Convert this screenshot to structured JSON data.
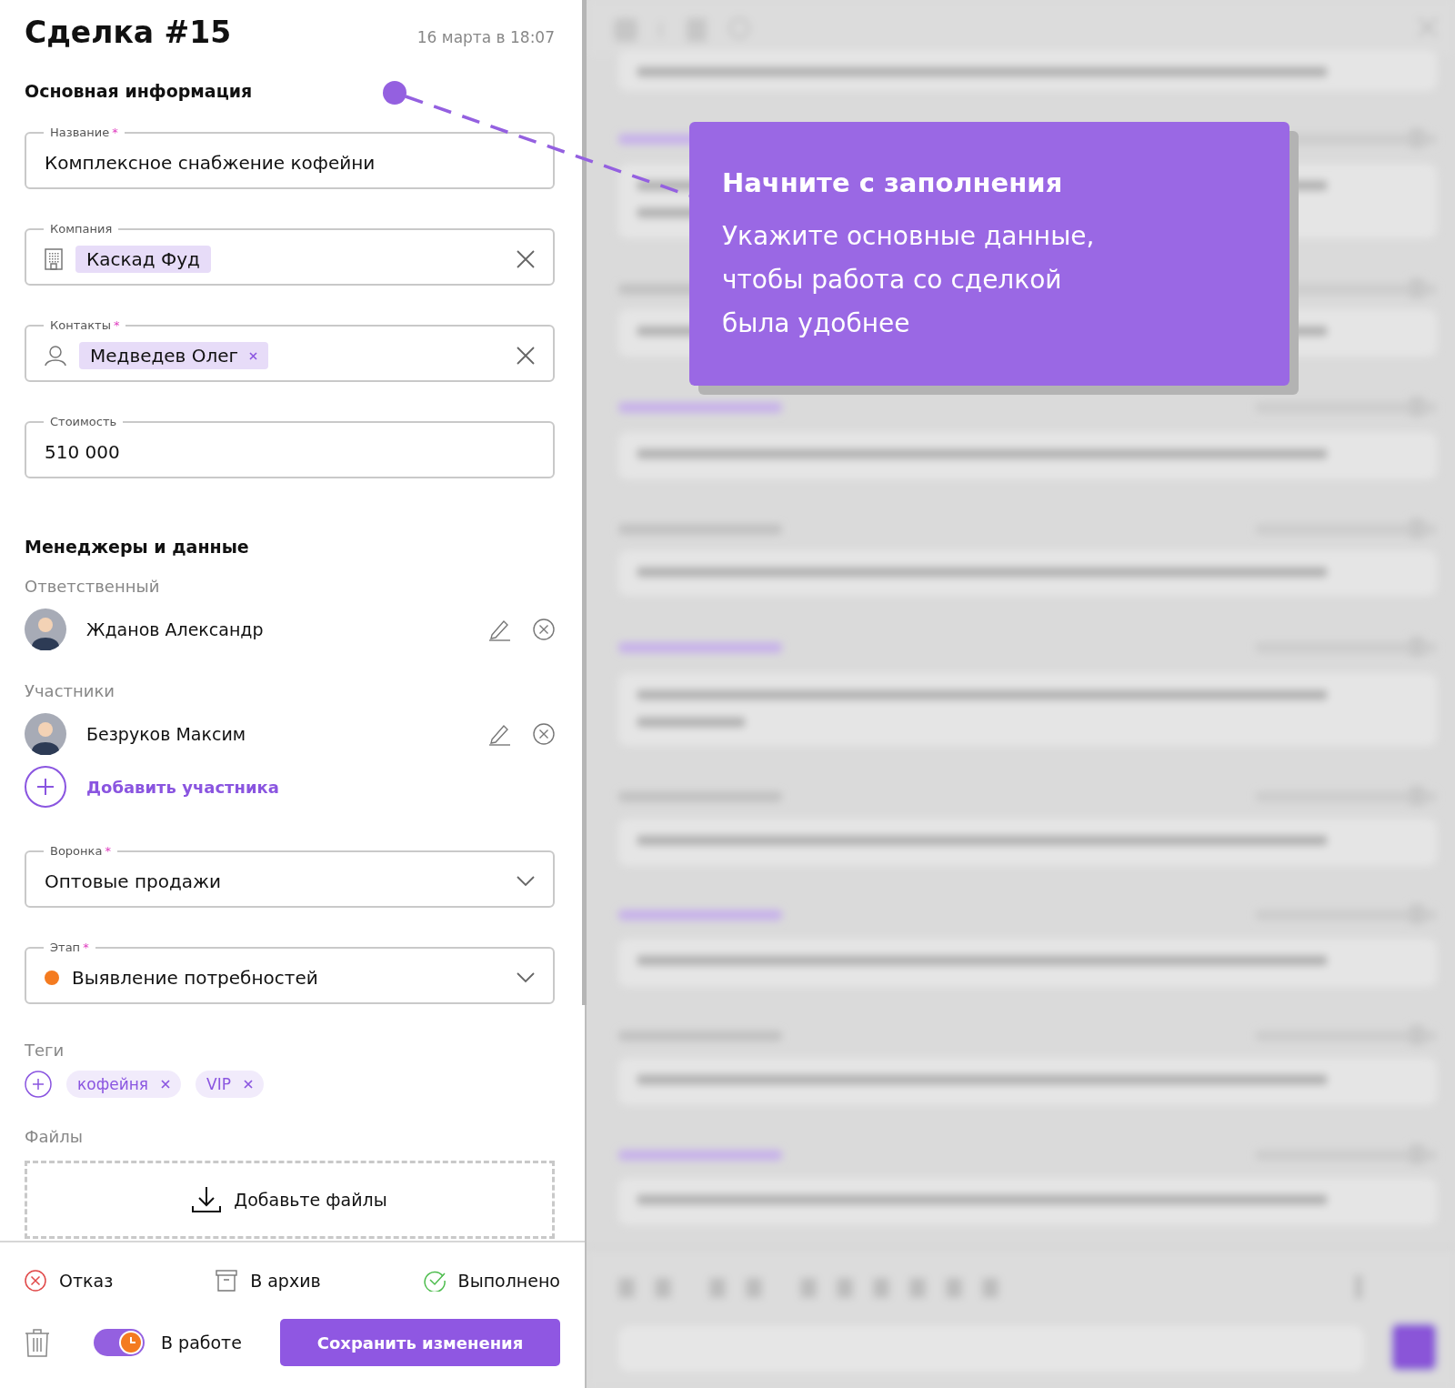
{
  "header": {
    "title": "Сделка #15",
    "date": "16 марта в 18:07"
  },
  "main_section": {
    "title": "Основная информация",
    "fields": [
      {
        "kind": "text",
        "label": "Название",
        "required_mark": "*",
        "value": "Комплексное снабжение кофейни"
      },
      {
        "kind": "company",
        "label": "Компания",
        "clearable": true,
        "chips": [
          {
            "label": "Каскад Фуд",
            "removable": false
          }
        ]
      },
      {
        "kind": "contacts",
        "label": "Контакты",
        "required_mark": "*",
        "clearable": true,
        "chips": [
          {
            "label": "Медведев Олег",
            "removable": true
          }
        ]
      },
      {
        "kind": "text",
        "label": "Стоимость",
        "value": "510 000"
      }
    ]
  },
  "managers_section": {
    "title": "Менеджеры и данные",
    "responsible": {
      "label": "Ответственный",
      "people": [
        {
          "name": "Жданов Александр"
        }
      ]
    },
    "participants": {
      "label": "Участники",
      "people": [
        {
          "name": "Безруков Максим"
        }
      ],
      "add_label": "Добавить участника"
    },
    "fields": [
      {
        "kind": "select",
        "label": "Воронка",
        "required_mark": "*",
        "value": "Оптовые продажи"
      },
      {
        "kind": "stage",
        "label": "Этап",
        "required_mark": "*",
        "value": "Выявление потребностей",
        "color": "#f47b20"
      }
    ],
    "tags": {
      "label": "Теги",
      "items": [
        "кофейня",
        "VIP"
      ]
    },
    "files": {
      "label": "Файлы",
      "drop_label": "Добавьте файлы"
    }
  },
  "actions": [
    {
      "kind": "reject",
      "label": "Отказ"
    },
    {
      "kind": "archive",
      "label": "В архив"
    },
    {
      "kind": "done",
      "label": "Выполнено"
    }
  ],
  "bottom": {
    "status_toggle": {
      "label": "В работе",
      "on": true
    },
    "save_label": "Сохранить изменения"
  },
  "tooltip": {
    "title": "Начните с заполнения",
    "text": "Укажите основные данные, чтобы работа со сделкой была удобнее"
  }
}
